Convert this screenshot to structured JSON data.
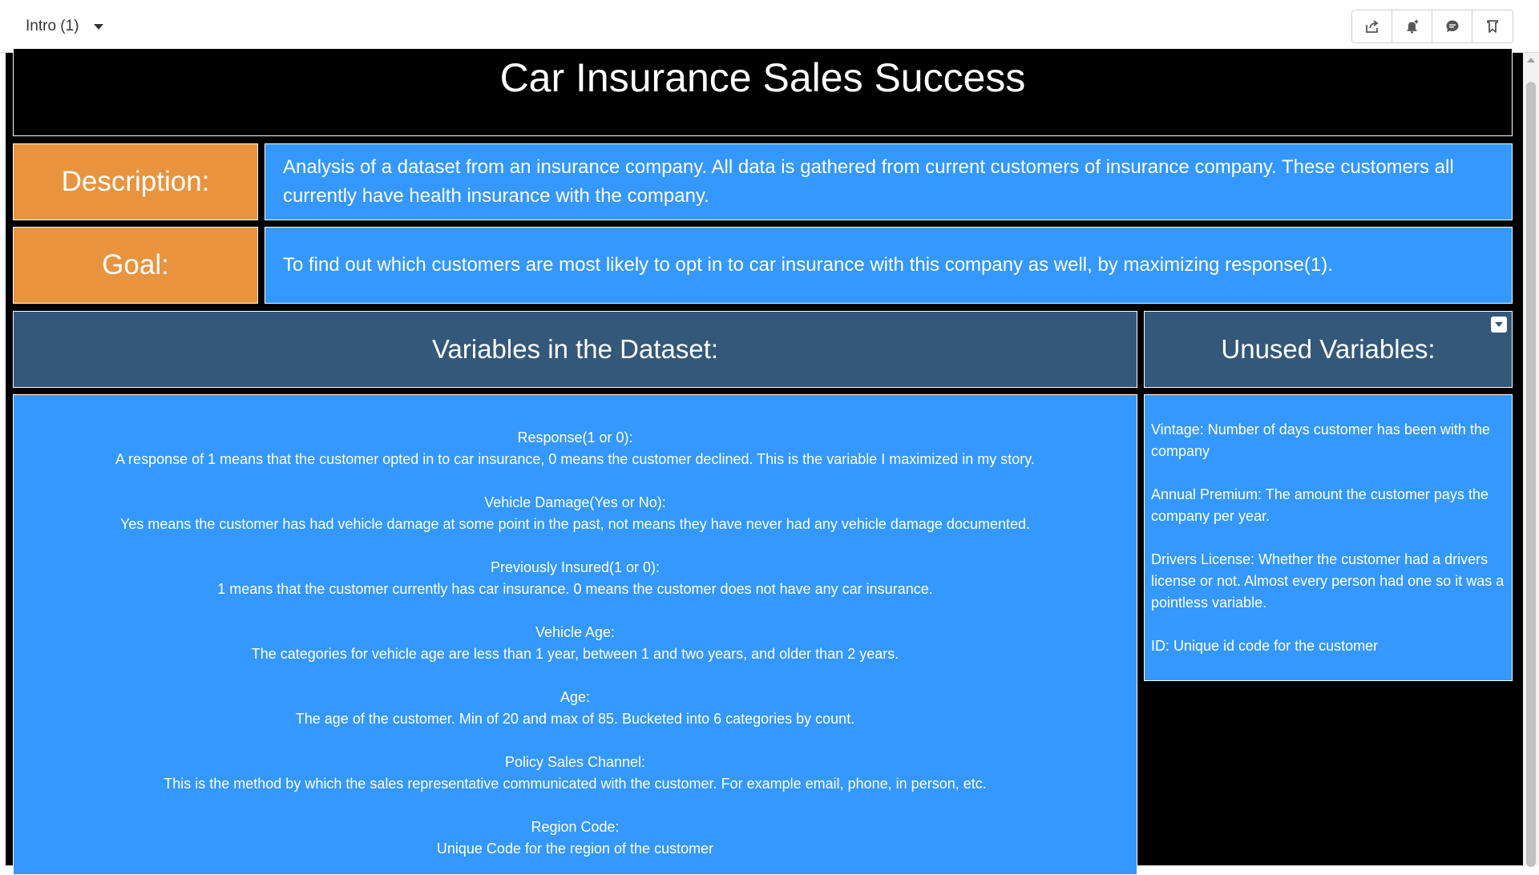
{
  "header": {
    "sheet_label": "Intro (1)",
    "toolbar_icons": [
      "share-icon",
      "notification-add-icon",
      "comment-icon",
      "bookmark-icon"
    ]
  },
  "story": {
    "title": "Car Insurance Sales Success",
    "description_label": "Description:",
    "description_text": "Analysis of a dataset from an insurance company. All data is gathered from current customers of insurance company. These customers all currently have health insurance with the company.",
    "goal_label": "Goal:",
    "goal_text": "To find out which customers are most likely to opt in to car insurance with this company as well, by maximizing response(1).",
    "variables_header": "Variables in the Dataset:",
    "unused_header": "Unused Variables:",
    "variables": [
      {
        "name": "Response(1 or 0):",
        "text": "A response of 1 means that the customer opted in to car insurance, 0 means the customer declined. This is the variable I maximized in my story."
      },
      {
        "name": "Vehicle Damage(Yes or No):",
        "text": "Yes means the customer has had vehicle damage at some point in the past, not means they have never had any vehicle damage documented."
      },
      {
        "name": "Previously Insured(1 or 0):",
        "text": "1 means that the customer currently has car insurance. 0 means the customer does not have any car insurance."
      },
      {
        "name": "Vehicle Age:",
        "text": "The categories for vehicle age are less than 1 year, between 1 and two years, and older than 2 years."
      },
      {
        "name": "Age:",
        "text": "The age of the customer. Min of 20 and max of 85. Bucketed into 6 categories by count."
      },
      {
        "name": "Policy Sales Channel:",
        "text": "This is the method by which the sales representative communicated with the customer. For example email, phone, in person, etc."
      },
      {
        "name": "Region Code:",
        "text": "Unique Code for the region of the customer"
      }
    ],
    "unused_variables": [
      "Vintage: Number of days customer has been with the company",
      "Annual Premium: The amount the customer pays the company per year.",
      "Drivers License: Whether the customer had a drivers license or not. Almost every person had one so it was a pointless variable.",
      "ID: Unique id code for the customer"
    ]
  },
  "colors": {
    "label_orange": "#e8943e",
    "text_blue": "#3498ff",
    "header_navy": "#33587a",
    "background": "#000000"
  }
}
